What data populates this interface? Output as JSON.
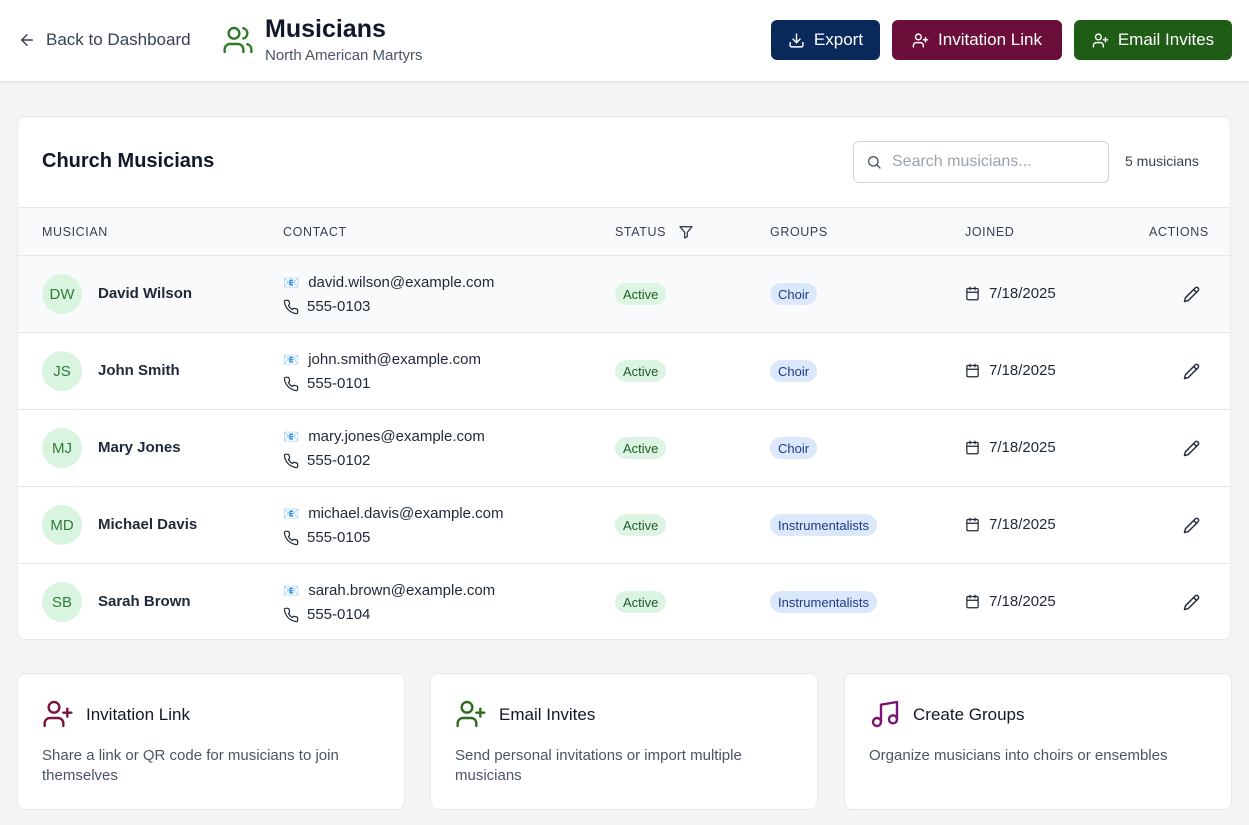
{
  "header": {
    "back_label": "Back to Dashboard",
    "title": "Musicians",
    "subtitle": "North American Martyrs",
    "buttons": {
      "export": "Export",
      "invitation_link": "Invitation Link",
      "email_invites": "Email Invites"
    },
    "colors": {
      "export": "#0b2a5c",
      "invitation_link": "#6b0f3a",
      "email_invites": "#1f5c16"
    }
  },
  "card": {
    "title": "Church Musicians",
    "search_placeholder": "Search musicians...",
    "count": "5 musicians",
    "columns": [
      "Musician",
      "Contact",
      "Status",
      "Groups",
      "Joined",
      "Actions"
    ],
    "rows": [
      {
        "initials": "DW",
        "name": "David Wilson",
        "email_icon": "📧",
        "email": "david.wilson@example.com",
        "phone": "555-0103",
        "status": "Active",
        "group": "Choir",
        "joined": "7/18/2025"
      },
      {
        "initials": "JS",
        "name": "John Smith",
        "email_icon": "📧",
        "email": "john.smith@example.com",
        "phone": "555-0101",
        "status": "Active",
        "group": "Choir",
        "joined": "7/18/2025"
      },
      {
        "initials": "MJ",
        "name": "Mary Jones",
        "email_icon": "📧",
        "email": "mary.jones@example.com",
        "phone": "555-0102",
        "status": "Active",
        "group": "Choir",
        "joined": "7/18/2025"
      },
      {
        "initials": "MD",
        "name": "Michael Davis",
        "email_icon": "📧",
        "email": "michael.davis@example.com",
        "phone": "555-0105",
        "status": "Active",
        "group": "Instrumentalists",
        "joined": "7/18/2025"
      },
      {
        "initials": "SB",
        "name": "Sarah Brown",
        "email_icon": "📧",
        "email": "sarah.brown@example.com",
        "phone": "555-0104",
        "status": "Active",
        "group": "Instrumentalists",
        "joined": "7/18/2025"
      }
    ]
  },
  "features": [
    {
      "icon": "user-plus-icon",
      "title": "Invitation Link",
      "description": "Share a link or QR code for musicians to join themselves",
      "color": "#7a1440"
    },
    {
      "icon": "user-plus-icon",
      "title": "Email Invites",
      "description": "Send personal invitations or import multiple musicians",
      "color": "#2f6b22"
    },
    {
      "icon": "music-note-icon",
      "title": "Create Groups",
      "description": "Organize musicians into choirs or ensembles",
      "color": "#7a1470"
    }
  ]
}
